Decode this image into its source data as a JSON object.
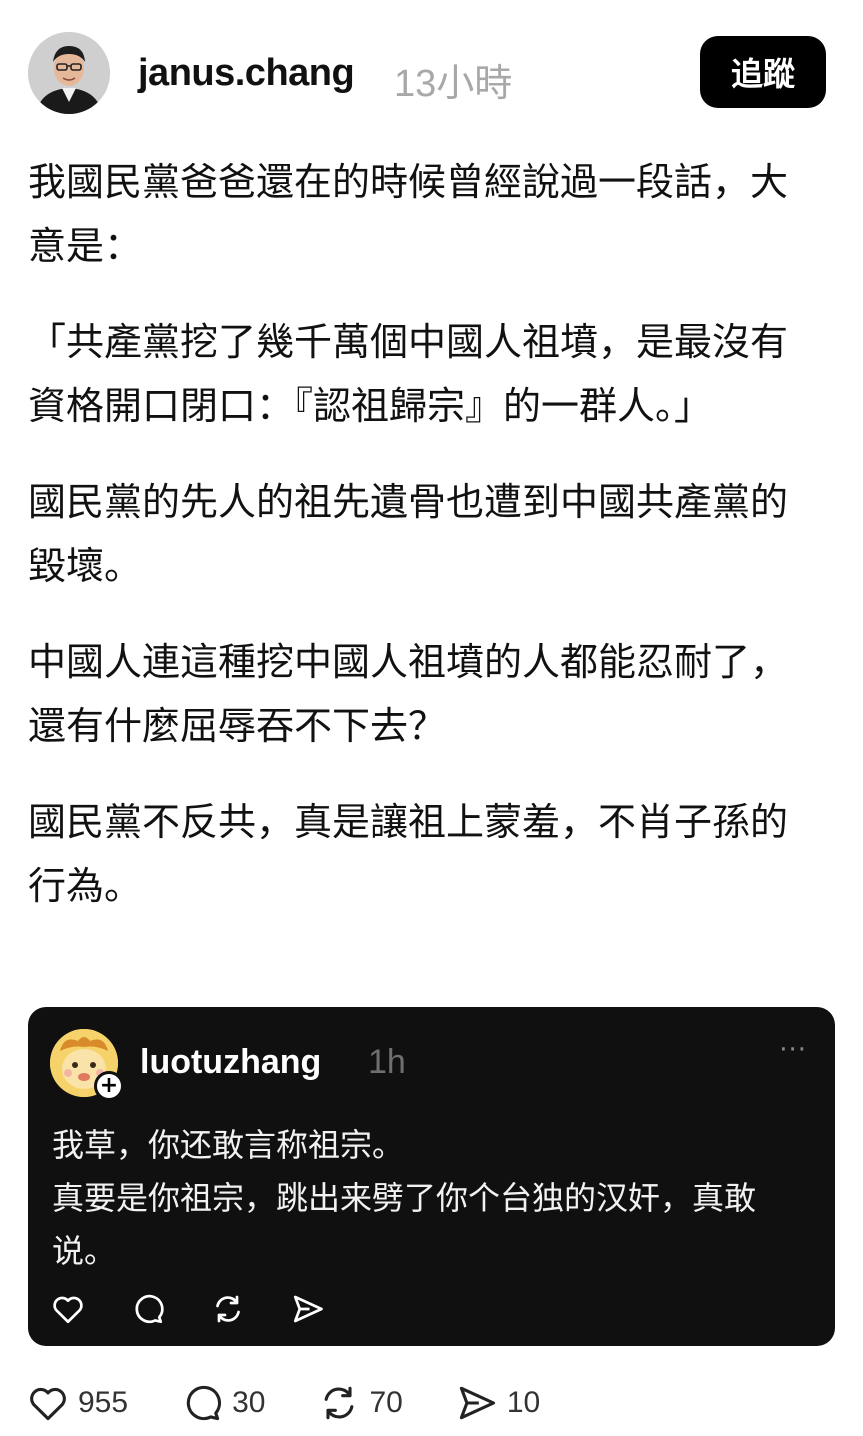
{
  "post": {
    "author": "janus.chang",
    "timestamp": "13小時",
    "follow_label": "追蹤",
    "paragraphs": [
      "我國民黨爸爸還在的時候曾經說過一段話，大意是：",
      "「共產黨挖了幾千萬個中國人祖墳，是最沒有資格開口閉口：『認祖歸宗』的一群人。」",
      "國民黨的先人的祖先遺骨也遭到中國共產黨的毀壞。",
      "中國人連這種挖中國人祖墳的人都能忍耐了，還有什麼屈辱吞不下去？",
      "國民黨不反共，真是讓祖上蒙羞，不肖子孫的行為。"
    ]
  },
  "quote": {
    "author": "luotuzhang",
    "timestamp": "1h",
    "more_label": "···",
    "plus_label": "+",
    "text": "我草，你还敢言称祖宗。\n真要是你祖宗，跳出来劈了你个台独的汉奸，真敢说。",
    "actions": [
      "heart-icon",
      "comment-icon",
      "repost-icon",
      "share-icon"
    ]
  },
  "actions": {
    "likes": "955",
    "comments": "30",
    "reposts": "70",
    "shares": "10"
  },
  "colors": {
    "follow_bg": "#000000",
    "quote_bg": "#101010",
    "timestamp": "#a8a8a8"
  }
}
